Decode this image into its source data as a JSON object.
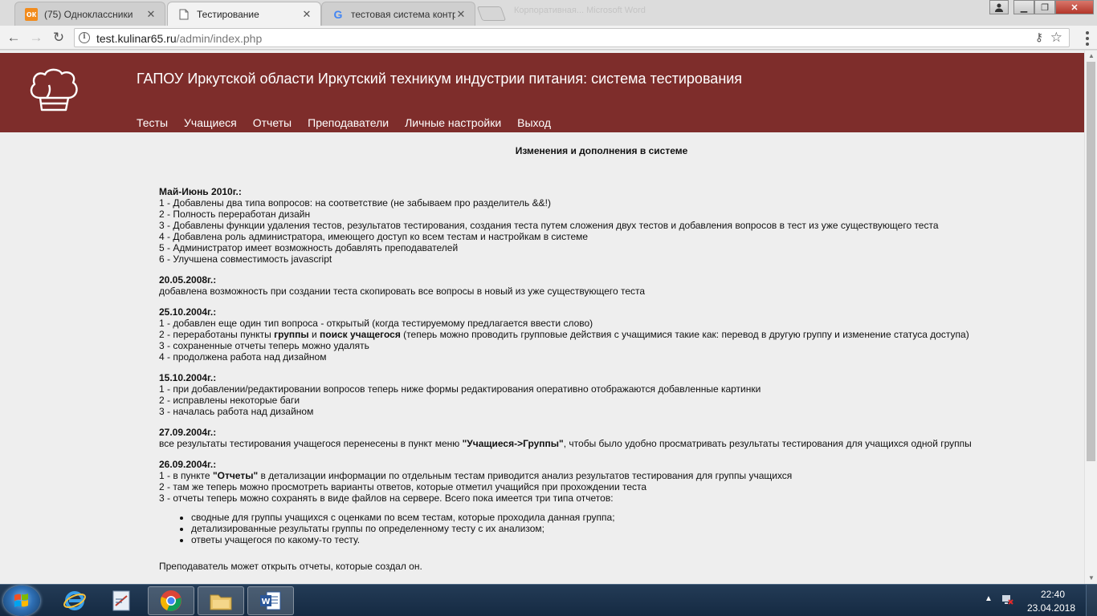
{
  "browser": {
    "tabs": [
      {
        "title": "(75) Одноклассники",
        "favicon": "odnoklassniki-icon",
        "active": false
      },
      {
        "title": "Тестирование",
        "favicon": "page-icon",
        "active": true
      },
      {
        "title": "тестовая система контр",
        "favicon": "google-icon",
        "active": false
      }
    ],
    "ghost_tab_text": "Корпоративная... Microsoft Word",
    "address": {
      "host": "test.kulinar65.ru",
      "path": "/admin/index.php"
    }
  },
  "site": {
    "title": "ГАПОУ Иркутской области Иркутский техникум индустрии питания: система тестирования",
    "nav": [
      "Тесты",
      "Учащиеся",
      "Отчеты",
      "Преподаватели",
      "Личные настройки",
      "Выход"
    ],
    "header_color": "#7e2d2b"
  },
  "content": {
    "heading": "Изменения и дополнения в системе",
    "entries": [
      {
        "date": "Май-Июнь 2010г.:",
        "lines": [
          "1 - Добавлены два типа вопросов: на соответствие (не забываем про разделитель &&!)",
          "2 - Полность переработан дизайн",
          "3 - Добавлены функции удаления тестов, результатов тестирования, создания теста путем сложения двух тестов и добавления вопросов в тест из уже существующего теста",
          "4 - Добавлена роль администратора, имеющего доступ ко всем тестам и настройкам в системе",
          "5 - Администратор имеет возможность добавлять преподавателей",
          "6 - Улучшена совместимость javascript"
        ]
      },
      {
        "date": "20.05.2008г.:",
        "lines": [
          "добавлена возможность при создании теста скопировать все вопросы в новый из уже существующего теста"
        ]
      },
      {
        "date": "25.10.2004г.:",
        "lines": [
          "1 - добавлен еще один тип вопроса - открытый (когда тестируемому предлагается ввести слово)",
          {
            "pre": "2 - переработаны пункты ",
            "b1": "группы",
            "mid": " и ",
            "b2": "поиск учащегося",
            "post": " (теперь можно проводить групповые действия с учащимися такие как: перевод в другую группу и изменение статуса доступа)"
          },
          "3 - сохраненные отчеты теперь можно удалять",
          "4 - продолжена работа над дизайном"
        ]
      },
      {
        "date": "15.10.2004г.:",
        "lines": [
          "1 - при добавлении/редактировании вопросов теперь ниже формы редактирования оперативно отображаются добавленные картинки",
          "2 - исправлены некоторые баги",
          "3 - началась работа над дизайном"
        ]
      },
      {
        "date": "27.09.2004г.:",
        "lines": [
          {
            "pre": "все результаты тестирования учащегося перенесены в пункт меню ",
            "b1": "\"Учащиеся->Группы\"",
            "post": ", чтобы было удобно просматривать результаты тестирования для учащихся одной группы"
          }
        ]
      },
      {
        "date": "26.09.2004г.:",
        "lines": [
          {
            "pre": "1 - в пункте ",
            "b1": "\"Отчеты\"",
            "post": " в детализации информации по отдельным тестам приводится анализ результатов тестирования для группы учащихся"
          },
          "2 - там же теперь можно просмотреть варианты ответов, которые отметил учащийся при прохождении теста",
          "3 - отчеты теперь можно сохранять в виде файлов на сервере. Всего пока имеется три типа отчетов:"
        ],
        "bullets": [
          "сводные для группы учащихся с оценками по всем тестам, которые проходила данная группа;",
          "детализированные результаты группы по определенному тесту с их анализом;",
          "ответы учащегося по какому-то тесту."
        ]
      }
    ],
    "footer_note": "Преподаватель может открыть отчеты, которые создал он."
  },
  "taskbar": {
    "clock_time": "22:40",
    "clock_date": "23.04.2018"
  }
}
